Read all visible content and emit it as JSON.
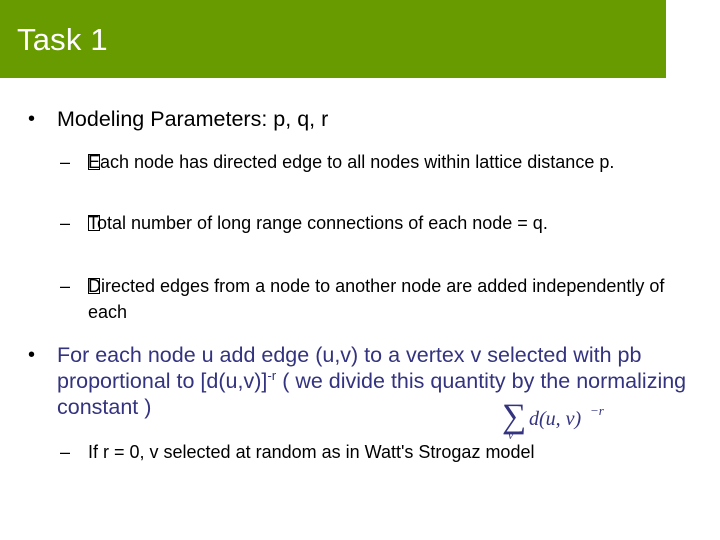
{
  "slide": {
    "title": "Task 1",
    "header_color": "#679b00",
    "title_color": "#ffffff",
    "body_text_color": "#000000",
    "accent_text_color": "#33337f",
    "background_color": "#ffffff"
  },
  "bullets": {
    "b1": {
      "marker": "•",
      "text": "Modeling Parameters: p, q, r"
    },
    "b1s1": {
      "marker": "–",
      "tofu": "�",
      "text": "Each node has directed edge to all nodes within lattice distance p."
    },
    "b1s2": {
      "marker": "–",
      "tofu": "�",
      "text": "Total number of long range connections of each node = q."
    },
    "b1s3": {
      "marker": "–",
      "tofu": "�",
      "text": "Directed edges from a node to another node are added independently of each"
    },
    "b2": {
      "marker": "•",
      "text_part1": "For each node u add edge (u,v) to a vertex v selected with pb proportional to [d(u,v)]",
      "superscript": "-r",
      "text_part2": " ( we divide this quantity by the normalizing constant                    )"
    },
    "b2s1": {
      "marker": "–",
      "text": "If r = 0, v selected at random as in Watt's Strogaz model"
    }
  },
  "equation": {
    "sigma": "∑",
    "sigma_subscript": "v",
    "expression": "d(u, v)",
    "exponent": "−r",
    "latex": "\\sum_{v} d(u,v)^{-r}",
    "color": "#33337f"
  }
}
